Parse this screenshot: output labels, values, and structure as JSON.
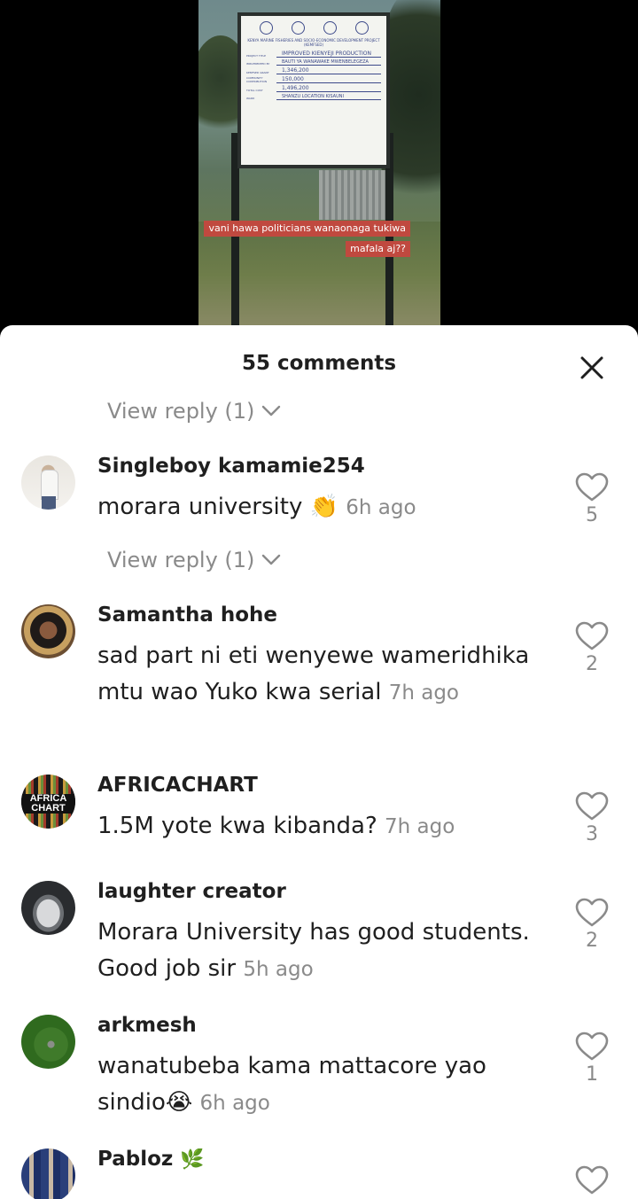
{
  "video": {
    "caption_line1": "vani hawa politicians wanaonaga tukiwa",
    "caption_line2": "mafala aj??",
    "board": {
      "project": "KENYA MARINE FISHERIES AND SOCIO-ECONOMIC DEVELOPMENT PROJECT (KEMFSED)",
      "rows": [
        {
          "key": "PROJECT TITLE",
          "value": "IMPROVED KIENYEJI PRODUCTION"
        },
        {
          "key": "IMPLEMENTED BY",
          "value": "BAUTI YA WANAWAKE MWENBELEGEZA"
        },
        {
          "key": "KEMFSED GRANT",
          "value": "1,346,200"
        },
        {
          "key": "COMMUNITY CONTRIBUTION",
          "value": "150,000"
        },
        {
          "key": "TOTAL COST",
          "value": "1,496,200"
        },
        {
          "key": "WARD",
          "value": "SHANZU     LOCATION   KISAUNI"
        }
      ]
    }
  },
  "sheet": {
    "title": "55 comments",
    "view_reply_label": "View reply (1)",
    "comments": [
      {
        "user": "Singleboy kamamie254",
        "text": "morara university",
        "emoji": "👏",
        "time": "6h ago",
        "likes": "5",
        "avatar": "person-photo"
      },
      {
        "user": "Samantha hohe",
        "text": "sad part ni eti wenyewe wameridhika mtu wao Yuko kwa serial",
        "emoji": "",
        "time": "7h ago",
        "likes": "2",
        "avatar": "woman-photo"
      },
      {
        "user": "AFRICACHART",
        "text": "1.5M yote kwa kibanda?",
        "emoji": "",
        "time": "7h ago",
        "likes": "3",
        "avatar": "africa-chart-logo"
      },
      {
        "user": "laughter creator",
        "text": "Morara University has good students. Good job sir",
        "emoji": "",
        "time": "5h ago",
        "likes": "2",
        "avatar": "car-photo"
      },
      {
        "user": "arkmesh",
        "text": "wanatubeba kama mattacore yao sindio",
        "emoji": "😭",
        "time": "6h ago",
        "likes": "1",
        "avatar": "grass-photo"
      },
      {
        "user": "Pabloz",
        "text": "",
        "emoji": "🌿",
        "time": "",
        "likes": "",
        "avatar": "group-photo"
      }
    ]
  },
  "icons": [
    "close-icon",
    "chevron-down-icon",
    "heart-icon"
  ]
}
